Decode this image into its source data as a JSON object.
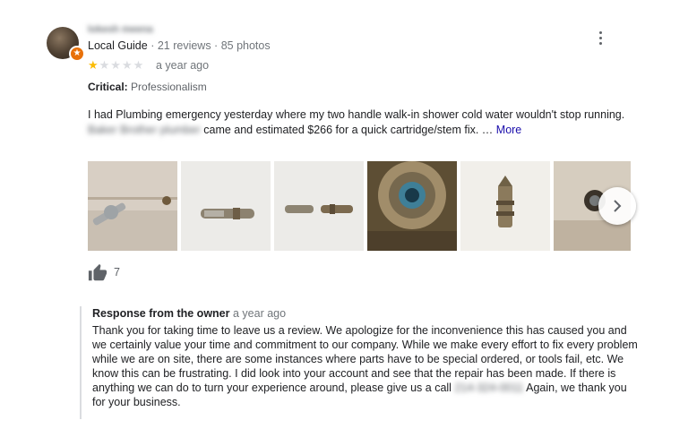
{
  "reviewer": {
    "name": "lokesh meena",
    "guide_label": "Local Guide",
    "separator": " · ",
    "reviews": "21 reviews",
    "photos": "85 photos",
    "avatar_icon": "user-avatar-photo",
    "badge_icon": "local-guide-star-icon"
  },
  "rating": {
    "value": 1,
    "max": 5,
    "star_filled": "★★",
    "star_empty": "★★★★",
    "time": "a year ago"
  },
  "critical": {
    "label": "Critical:",
    "value": "Professionalism"
  },
  "review": {
    "text_part1": "I had Plumbing emergency yesterday where my two handle walk-in shower cold water wouldn't stop running.",
    "blurred_name": "Baker Brother plumber",
    "text_part2": " came and estimated $266 for a quick cartridge/stem fix. … ",
    "more_label": "More"
  },
  "photos": [
    "faucet-handle",
    "stem-part",
    "two-stems",
    "valve-inside",
    "cartridge",
    "valve-wall"
  ],
  "likes": {
    "icon": "thumbs-up-icon",
    "count": "7"
  },
  "owner": {
    "title": "Response from the owner",
    "time": "a year ago",
    "text_main": "Thank you for taking time to leave us a review. We apologize for the inconvenience this has caused you and we certainly value your time and commitment to our company. While we make every effort to fix every problem while we are on site, there are some instances where parts have to be special ordered, or tools fail, etc. We know this can be frustrating. I did look into your account and see that the repair has been made. If there is anything we can do to turn your experience around, please give us a call ",
    "phone": "214-324-0011",
    "text_end": " Again, we thank you for your business."
  },
  "colors": {
    "star": "#fbbc04",
    "link": "#1a0dab",
    "badge": "#e8710a",
    "text": "#202124",
    "muted": "#70757a"
  }
}
